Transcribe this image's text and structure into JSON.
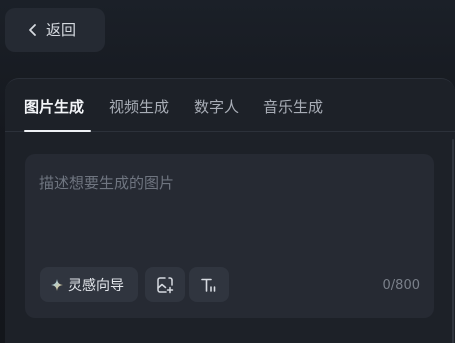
{
  "header": {
    "back_label": "返回"
  },
  "tabs": [
    {
      "label": "图片生成",
      "active": true
    },
    {
      "label": "视频生成",
      "active": false
    },
    {
      "label": "数字人",
      "active": false
    },
    {
      "label": "音乐生成",
      "active": false
    }
  ],
  "prompt": {
    "placeholder": "描述想要生成的图片",
    "value": "",
    "char_count": "0/800"
  },
  "toolbar": {
    "inspire_label": "灵感向导",
    "image_ref_icon": "image-add-icon",
    "text_style_icon": "text-format-icon"
  },
  "colors": {
    "background": "#13161c",
    "panel": "#1d2128",
    "input_box": "#262a33",
    "button": "#30353f",
    "active_tab": "#f3f5f8",
    "inactive_tab": "#a8adb6",
    "placeholder": "#6f7580"
  }
}
